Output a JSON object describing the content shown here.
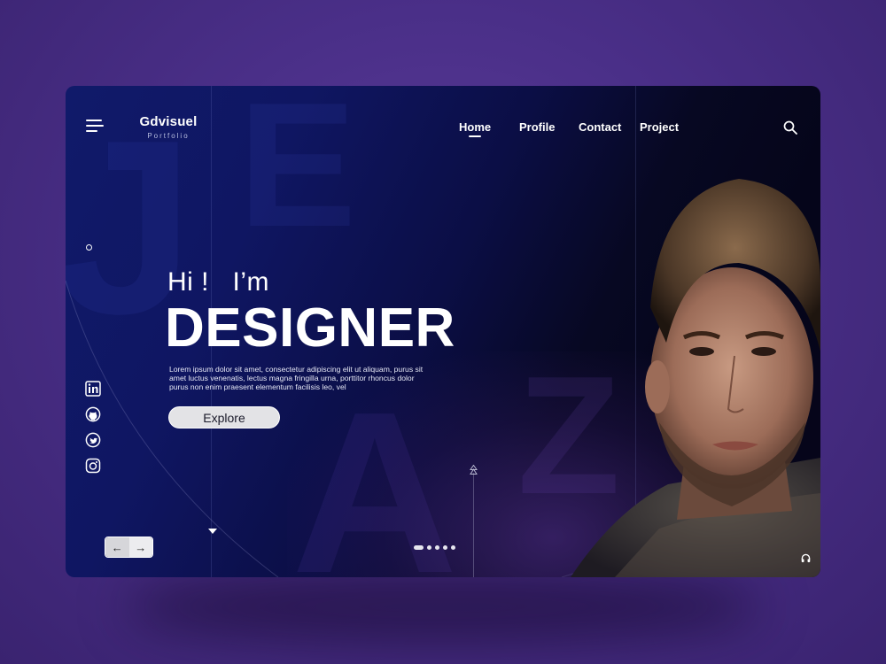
{
  "brand": {
    "name": "Gdvisuel",
    "subtitle": "Portfolio"
  },
  "nav": {
    "items": [
      {
        "label": "Home",
        "active": true
      },
      {
        "label": "Profile",
        "active": false
      },
      {
        "label": "Contact",
        "active": false
      },
      {
        "label": "Project",
        "active": false
      }
    ]
  },
  "background_letters": [
    "J",
    "E",
    "A",
    "Z"
  ],
  "hero": {
    "greeting": "Hi !   I’m",
    "title": "DESIGNER",
    "description": "Lorem ipsum dolor sit amet, consectetur adipiscing elit ut aliquam, purus sit amet luctus venenatis, lectus magna fringilla urna, porttitor rhoncus dolor purus non enim praesent elementum facilisis leo, vel",
    "cta_label": "Explore"
  },
  "socials": [
    {
      "name": "linkedin",
      "icon": "linkedin-icon"
    },
    {
      "name": "github",
      "icon": "github-icon"
    },
    {
      "name": "twitter",
      "icon": "twitter-icon"
    },
    {
      "name": "instagram",
      "icon": "instagram-icon"
    }
  ],
  "pager": {
    "prev_symbol": "←",
    "next_symbol": "→"
  },
  "carousel": {
    "total": 5,
    "active_index": 0
  },
  "colors": {
    "card_bg_start": "#101a6a",
    "card_bg_end": "#05051a",
    "page_bg": "#4a2f88",
    "text": "#ffffff",
    "button_bg": "#e3e3e6"
  }
}
